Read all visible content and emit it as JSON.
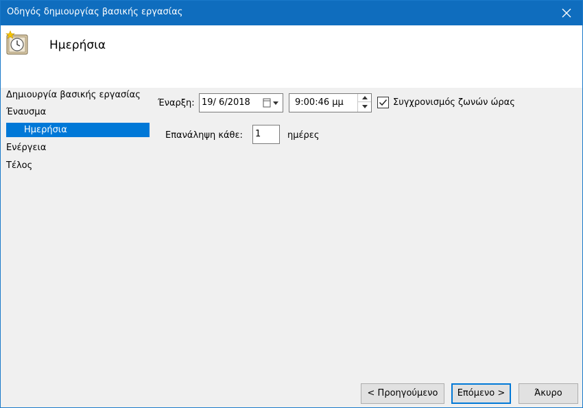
{
  "window": {
    "title": "Οδηγός δημιουργίας βασικής εργασίας",
    "close_glyph": "✕"
  },
  "header": {
    "heading": "Ημερήσια"
  },
  "nav": {
    "items": [
      {
        "label": "Δημιουργία βασικής εργασίας"
      },
      {
        "label": "Έναυσμα"
      },
      {
        "label": "Ημερήσια",
        "selected": true
      },
      {
        "label": "Ενέργεια"
      },
      {
        "label": "Τέλος"
      }
    ]
  },
  "form": {
    "start_label": "Έναρξη:",
    "start_date": "19/  6/2018",
    "start_time": "9:00:46 μμ",
    "sync_timezones_label": "Συγχρονισμός ζωνών ώρας",
    "sync_timezones_checked": true,
    "repeat_label": "Επανάληψη κάθε:",
    "repeat_value": "1",
    "repeat_unit": "ημέρες"
  },
  "buttons": {
    "back": "< Προηγούμενο",
    "next": "Επόμενο >",
    "cancel": "Άκυρο"
  },
  "colors": {
    "titlebar": "#0f6dbe",
    "selection": "#0078d7",
    "panel": "#f0f0f0"
  },
  "icons": {
    "header": "scheduled-task-clock-icon",
    "date_picker": "calendar-dropdown-icon",
    "spin_up": "arrow-up-icon",
    "spin_down": "arrow-down-icon",
    "checkbox": "checkmark-icon",
    "close": "close-icon"
  }
}
